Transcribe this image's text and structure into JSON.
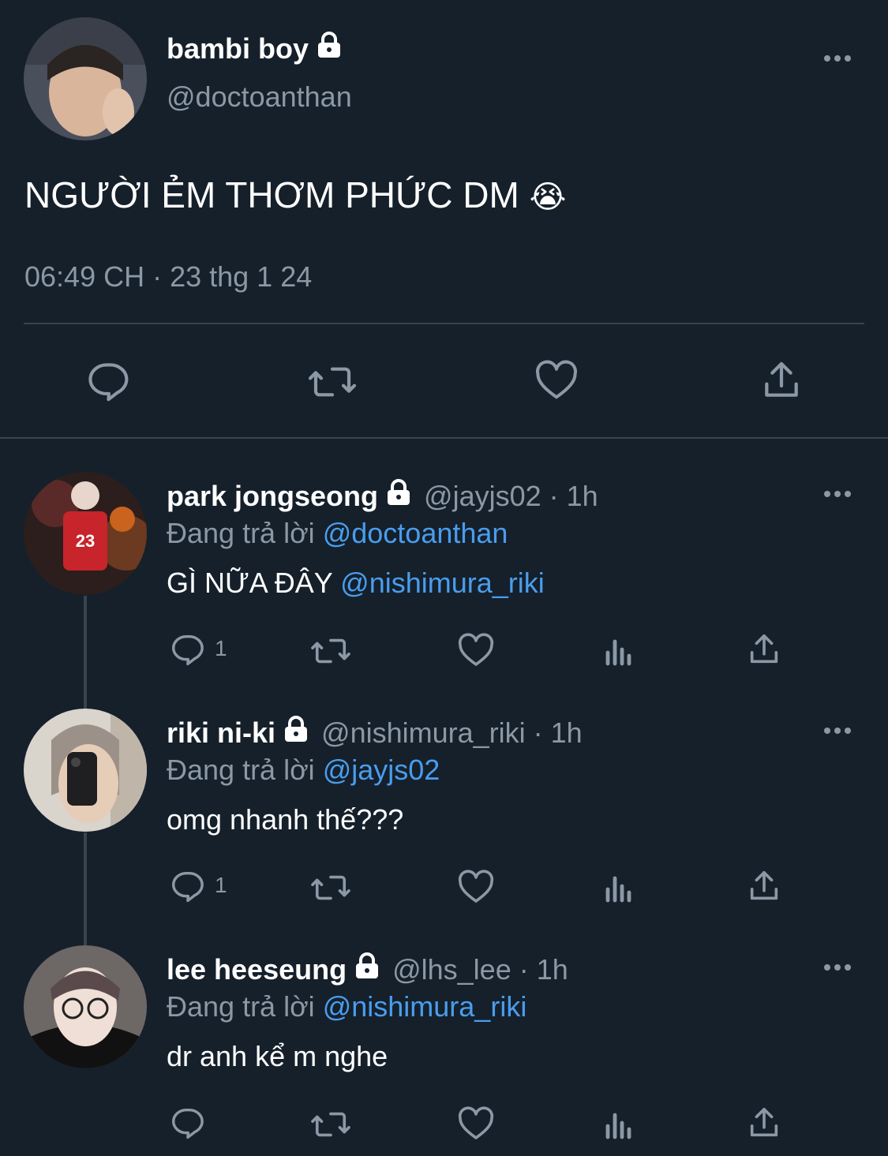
{
  "main_tweet": {
    "display_name": "bambi boy",
    "handle": "@doctoanthan",
    "text": "NGƯỜI ẺM THƠM PHỨC DM",
    "emoji": "😭",
    "timestamp": "06:49 CH · 23 thg 1 24"
  },
  "replies": [
    {
      "display_name": "park jongseong",
      "handle": "@jayjs02",
      "time": "· 1h",
      "replying_prefix": "Đang trả lời",
      "replying_to": "@doctoanthan",
      "text_plain": "GÌ NỮA ĐÂY",
      "text_mention": "@nishimura_riki",
      "reply_count": "1"
    },
    {
      "display_name": "riki ni-ki",
      "handle": "@nishimura_riki",
      "time": "· 1h",
      "replying_prefix": "Đang trả lời",
      "replying_to": "@jayjs02",
      "text_plain": "omg nhanh thế???",
      "text_mention": "",
      "reply_count": "1"
    },
    {
      "display_name": "lee heeseung",
      "handle": "@lhs_lee",
      "time": "· 1h",
      "replying_prefix": "Đang trả lời",
      "replying_to": "@nishimura_riki",
      "text_plain": "dr anh kể m nghe",
      "text_mention": "",
      "reply_count": ""
    }
  ],
  "icons": {
    "reply": "reply-icon",
    "retweet": "retweet-icon",
    "like": "like-icon",
    "share": "share-icon",
    "views": "views-icon",
    "lock": "lock-icon",
    "more": "more-icon"
  },
  "colors": {
    "background": "#15202b",
    "muted": "#8b98a5",
    "link": "#4a9ded",
    "divider": "#38444d"
  }
}
